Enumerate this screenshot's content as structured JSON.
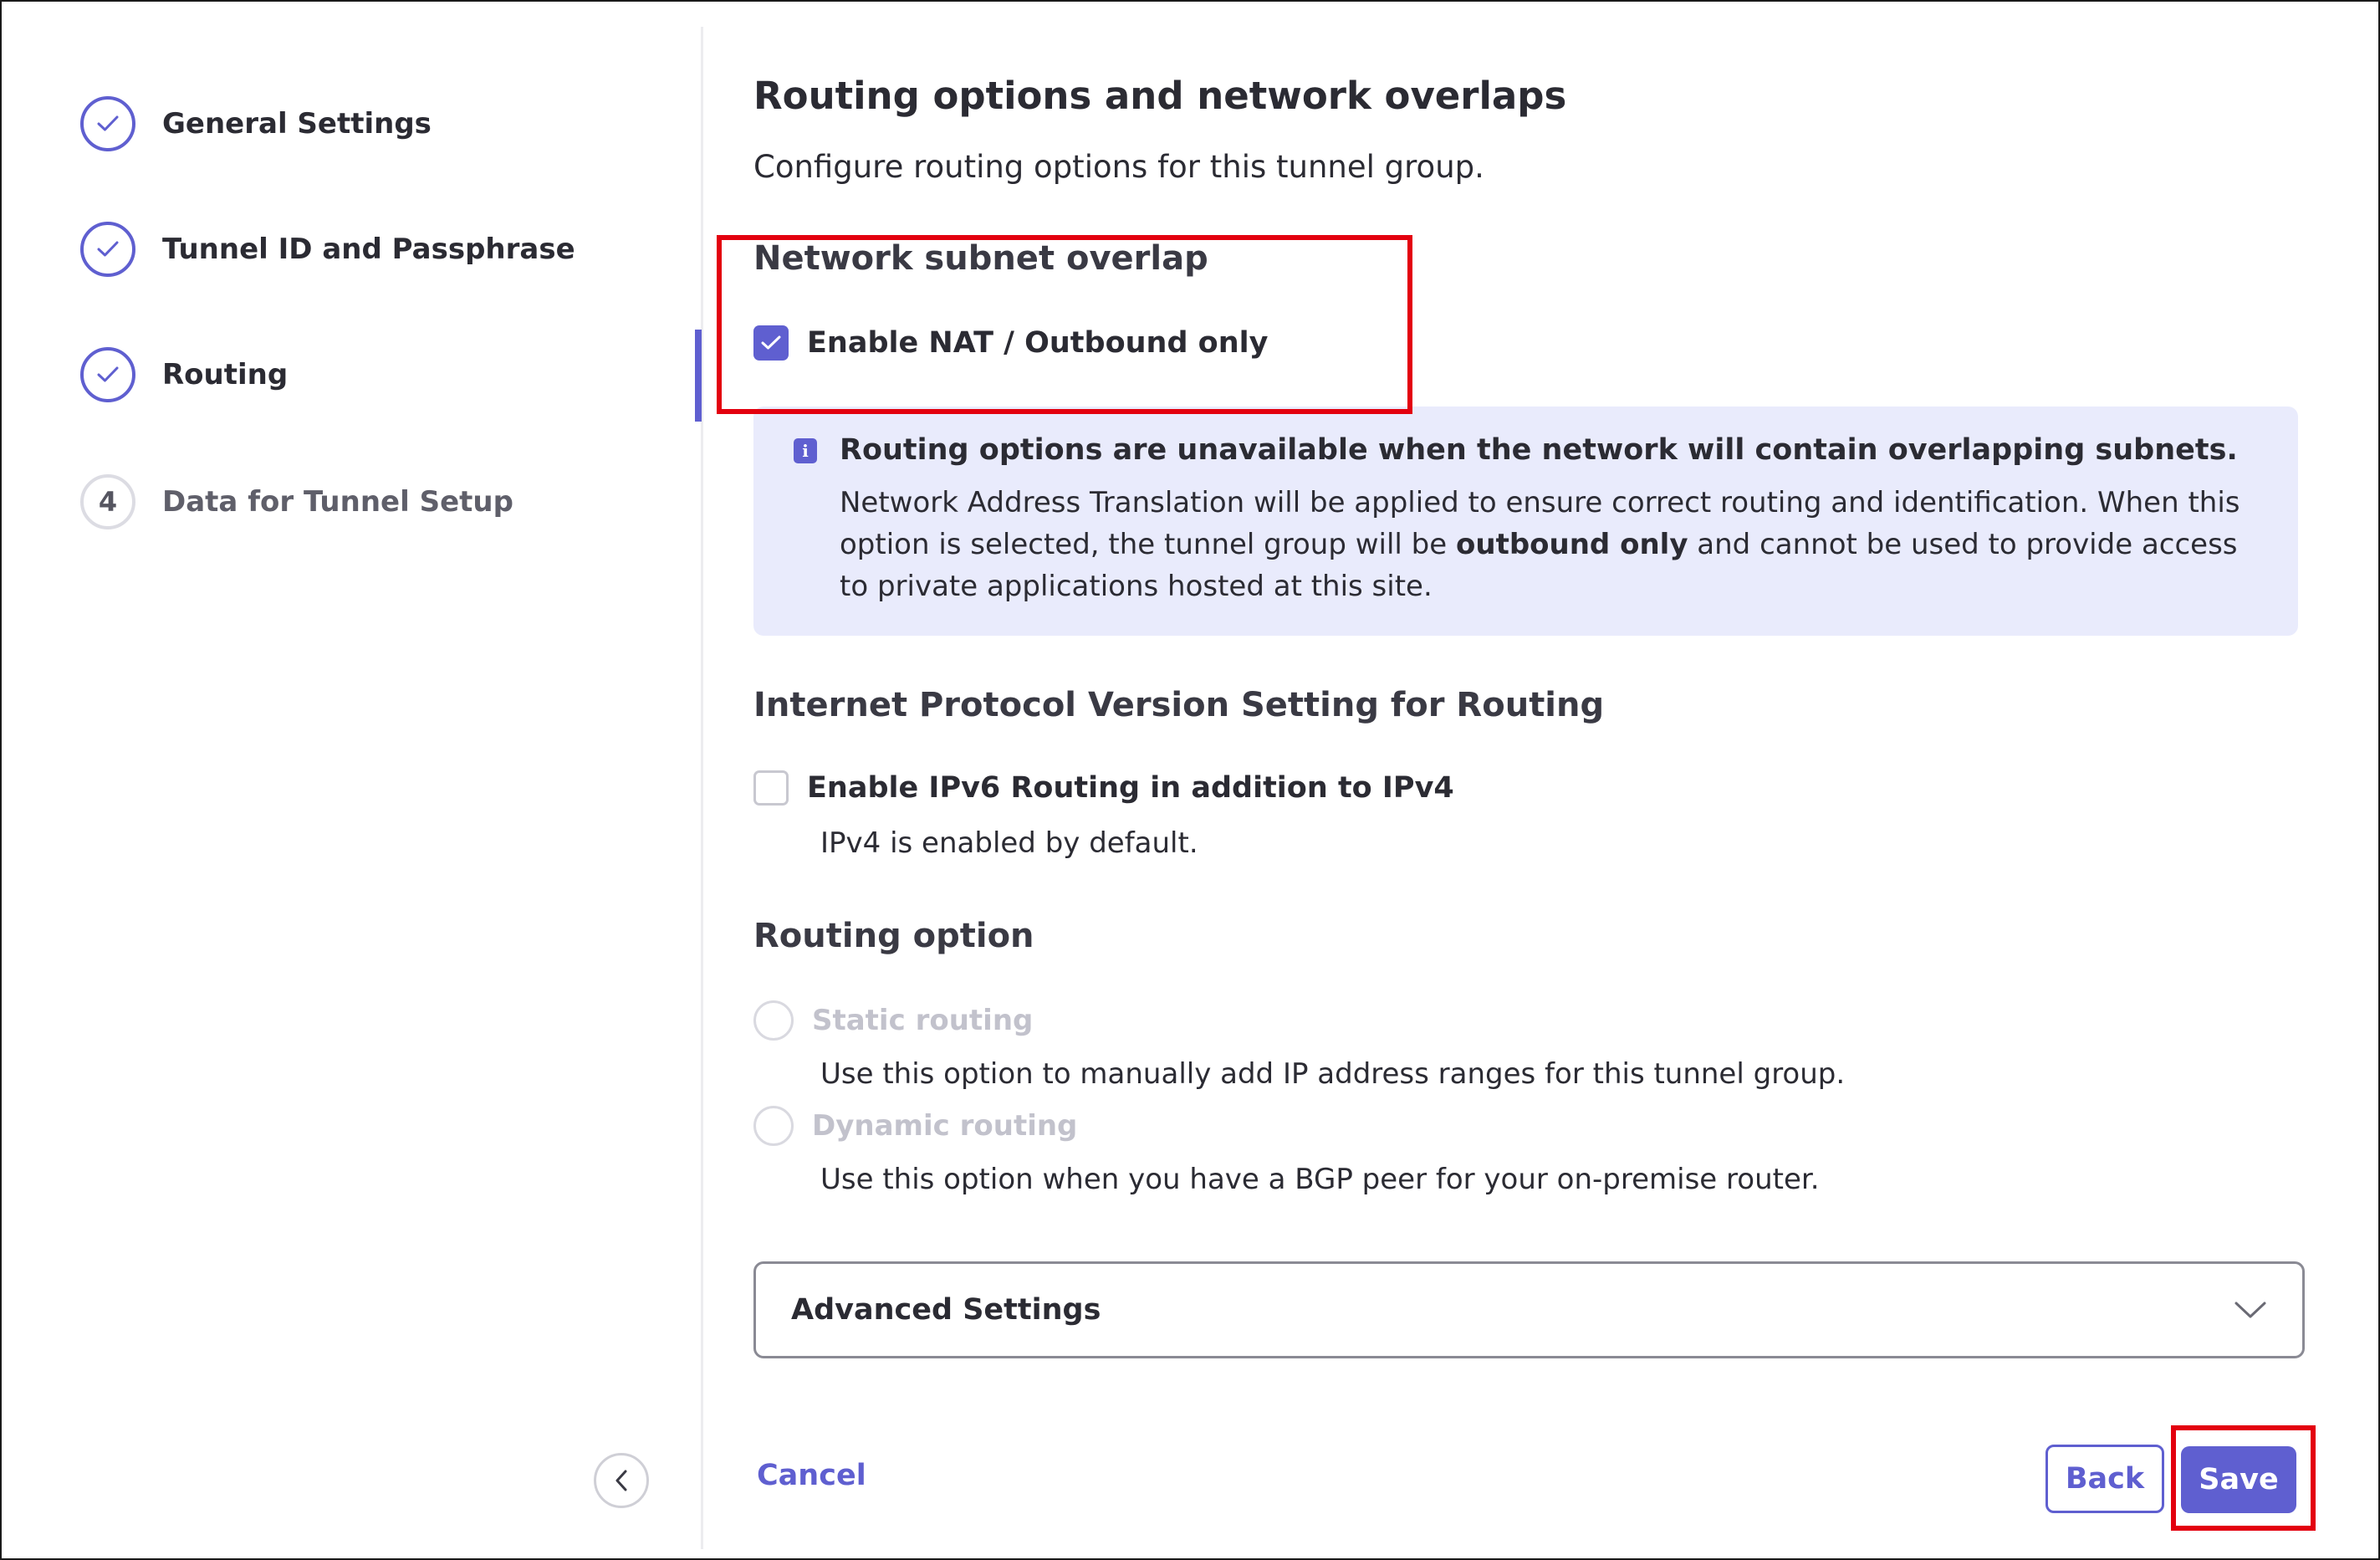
{
  "sidebar": {
    "steps": [
      {
        "label": "General Settings",
        "status": "complete",
        "icon": "check-icon"
      },
      {
        "label": "Tunnel ID and Passphrase",
        "status": "complete",
        "icon": "check-icon"
      },
      {
        "label": "Routing",
        "status": "complete",
        "icon": "check-icon"
      },
      {
        "label": "Data for Tunnel Setup",
        "status": "pending",
        "number": "4"
      }
    ],
    "collapse_icon": "chevron-left-icon"
  },
  "main": {
    "title": "Routing options and network overlaps",
    "subtitle": "Configure routing options for this tunnel group.",
    "subnet_overlap": {
      "heading": "Network subnet overlap",
      "nat_checkbox_label": "Enable NAT / Outbound only",
      "nat_checked": true
    },
    "info": {
      "icon": "info-icon",
      "heading": "Routing options are unavailable when the network will contain overlapping subnets.",
      "body_before": "Network Address Translation will be applied to ensure correct routing and identification. When this option is selected, the tunnel group will be ",
      "body_bold": "outbound only",
      "body_after": " and cannot be used to provide access to private applications hosted at this site."
    },
    "ip_version": {
      "heading": "Internet Protocol Version Setting for Routing",
      "ipv6_checkbox_label": "Enable IPv6 Routing in addition to IPv4",
      "ipv6_checked": false,
      "helper": "IPv4 is enabled by default."
    },
    "routing_option": {
      "heading": "Routing option",
      "options": [
        {
          "label": "Static routing",
          "description": "Use this option to manually add IP address ranges for this tunnel group.",
          "disabled": true
        },
        {
          "label": "Dynamic routing",
          "description": "Use this option when you have a BGP peer for your on-premise router.",
          "disabled": true
        }
      ]
    },
    "advanced": {
      "label": "Advanced Settings",
      "icon": "chevron-down-icon"
    }
  },
  "footer": {
    "cancel_label": "Cancel",
    "back_label": "Back",
    "save_label": "Save"
  },
  "colors": {
    "accent": "#5f5fd0",
    "info_bg": "#e9ebfc",
    "highlight": "#e3000f"
  }
}
